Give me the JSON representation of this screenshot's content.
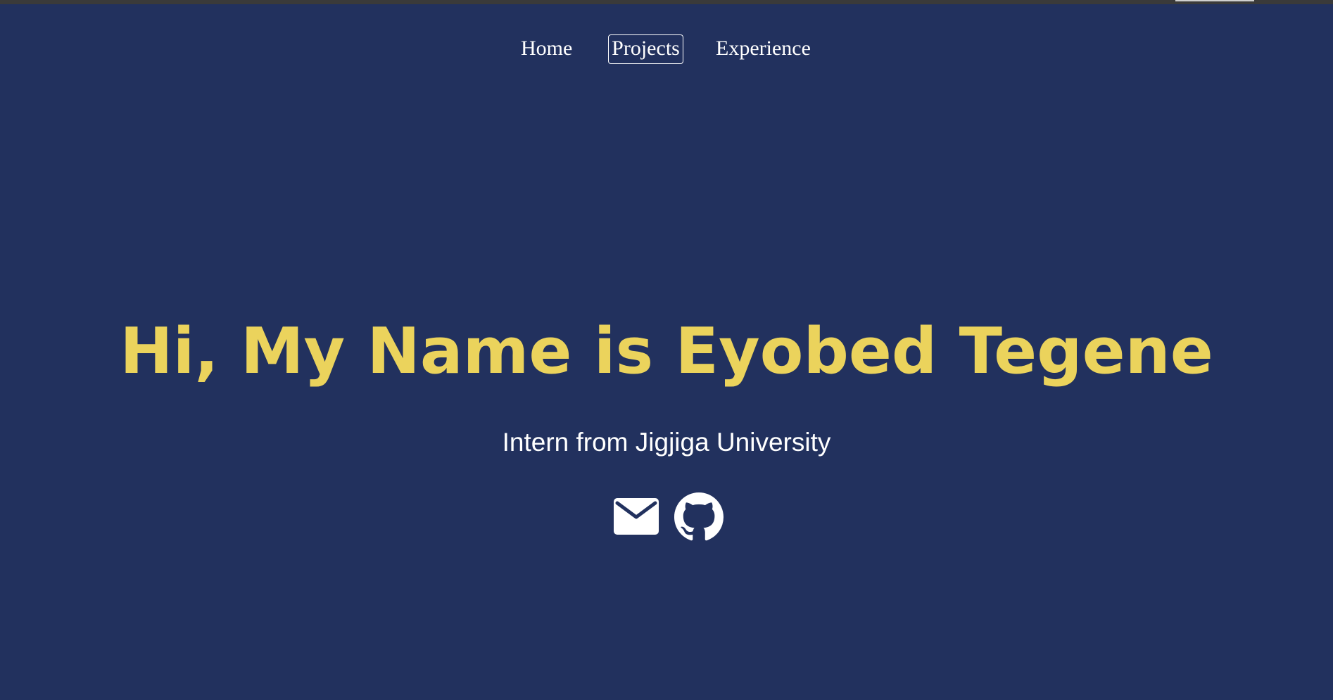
{
  "nav": {
    "items": [
      {
        "label": "Home"
      },
      {
        "label": "Projects"
      },
      {
        "label": "Experience"
      }
    ]
  },
  "hero": {
    "title": "Hi, My Name is Eyobed Tegene",
    "subtitle": "Intern from Jigjiga University"
  },
  "social": {
    "icons": [
      "mail-icon",
      "github-icon"
    ]
  },
  "colors": {
    "background": "#22315e",
    "accent": "#ebd35c",
    "text": "#ffffff"
  }
}
